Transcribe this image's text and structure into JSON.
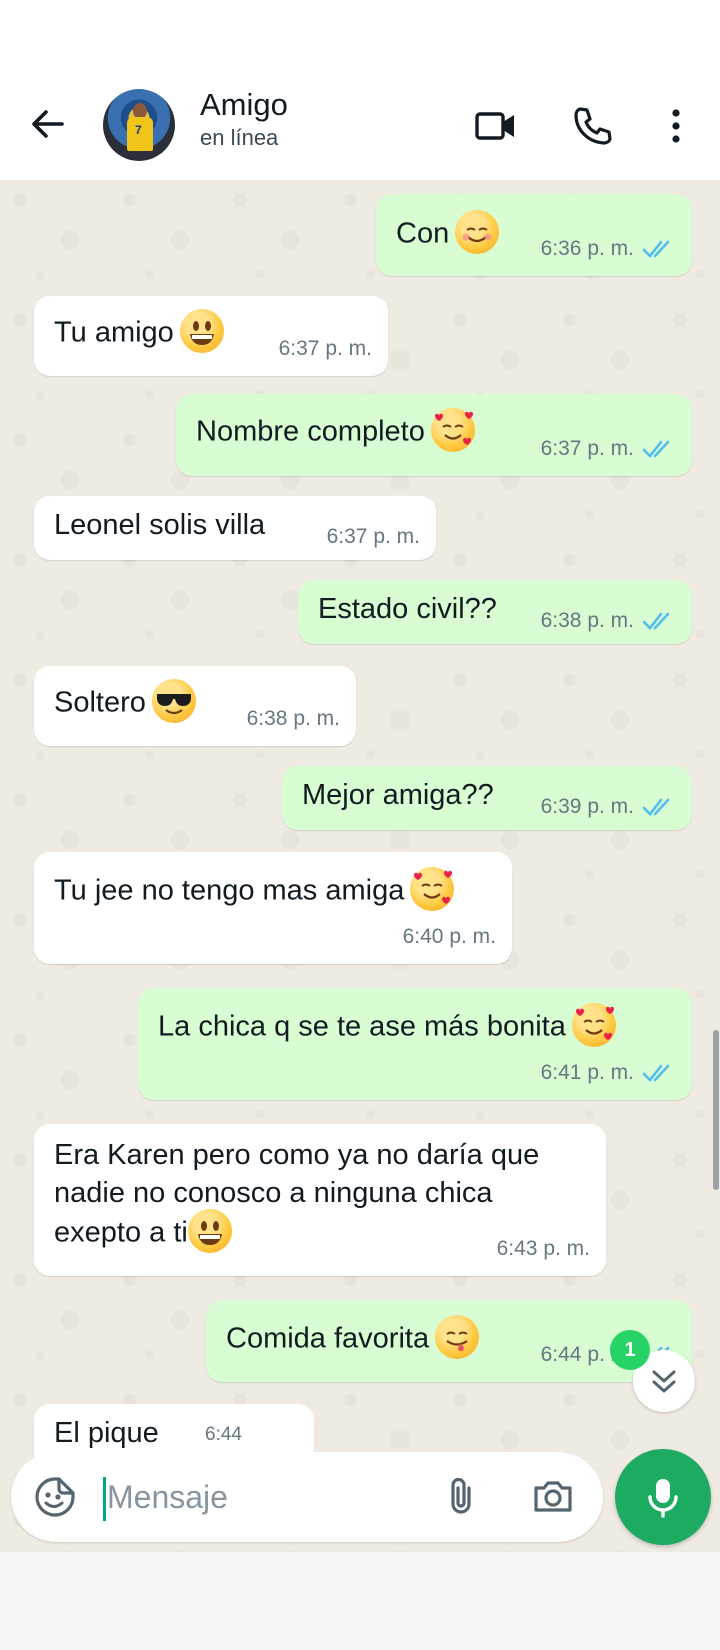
{
  "header": {
    "contact_name": "Amigo",
    "status": "en línea",
    "avatar_jersey_number": "7",
    "icons": [
      "back-arrow-icon",
      "video-call-icon",
      "phone-icon",
      "more-vert-icon"
    ]
  },
  "messages": [
    {
      "dir": "out",
      "text": "Con",
      "emoji": "smiling-face-icon",
      "time": "6:36 p. m.",
      "read": true
    },
    {
      "dir": "in",
      "text": "Tu amigo",
      "emoji": "grinning-face-icon",
      "time": "6:37 p. m."
    },
    {
      "dir": "out",
      "text": "Nombre completo",
      "emoji": "smiling-hearts-icon",
      "time": "6:37 p. m.",
      "read": true
    },
    {
      "dir": "in",
      "text": "Leonel solis villa",
      "time": "6:37 p. m."
    },
    {
      "dir": "out",
      "text": "Estado civil??",
      "time": "6:38 p. m.",
      "read": true
    },
    {
      "dir": "in",
      "text": "Soltero",
      "emoji": "sunglasses-face-icon",
      "time": "6:38 p. m."
    },
    {
      "dir": "out",
      "text": "Mejor amiga??",
      "time": "6:39 p. m.",
      "read": true
    },
    {
      "dir": "in",
      "text": "Tu jee no tengo mas amiga",
      "emoji": "smiling-hearts-icon",
      "time": "6:40 p. m."
    },
    {
      "dir": "out",
      "text": "La chica q se te ase más bonita",
      "emoji": "smiling-hearts-icon",
      "time": "6:41 p. m.",
      "read": true
    },
    {
      "dir": "in",
      "lines": [
        "Era Karen pero como ya no daría que",
        "nadie no conosco a ninguna chica",
        "exepto a ti"
      ],
      "emoji": "grinning-face-icon",
      "time": "6:43 p. m."
    },
    {
      "dir": "out",
      "text": "Comida favorita",
      "emoji": "yum-face-icon",
      "time": "6:44 p. m.",
      "read": true
    },
    {
      "dir": "in",
      "text": "El pique",
      "time": "6:44"
    }
  ],
  "unread_badge": "1",
  "composer": {
    "placeholder": "Mensaje"
  },
  "colors": {
    "outgoing_bubble": "#d9fdd3",
    "incoming_bubble": "#ffffff",
    "chat_background": "#efeae2",
    "read_ticks": "#53bdeb",
    "accent_green": "#1daa61"
  }
}
